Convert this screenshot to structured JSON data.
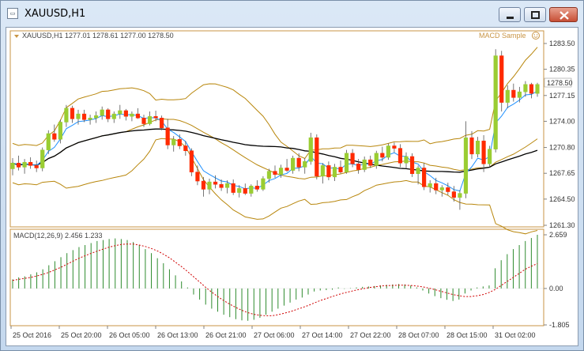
{
  "window": {
    "title": "XAUUSD,H1",
    "icon": "chart-window-icon",
    "controls": [
      "minimize-icon",
      "maximize-icon",
      "close-icon"
    ]
  },
  "chart_header": {
    "symbol_info": "XAUUSD,H1  1277.01 1278.61 1277.00 1278.50",
    "indicator_name": "MACD Sample",
    "indicator_icon": "smiley-face-icon"
  },
  "macd_label": "MACD(12,26,9) 2.456 1.233",
  "price_axis": {
    "labels": [
      "1283.50",
      "1280.35",
      "1277.15",
      "1274.00",
      "1270.80",
      "1267.65",
      "1264.50",
      "1261.30"
    ],
    "current_price": "1278.50"
  },
  "macd_axis": {
    "labels": [
      "2.659",
      "0.00",
      "-1.805"
    ]
  },
  "time_axis": {
    "labels": [
      "25 Oct 2016",
      "25 Oct 20:00",
      "26 Oct 05:00",
      "26 Oct 13:00",
      "26 Oct 21:00",
      "27 Oct 06:00",
      "27 Oct 14:00",
      "27 Oct 22:00",
      "28 Oct 07:00",
      "28 Oct 15:00",
      "31 Oct 02:00"
    ]
  },
  "colors": {
    "bull_candle": "#9acd32",
    "bear_candle": "#ff2a00",
    "bollinger": "#b8860b",
    "fast_ma": "#1e90ff",
    "slow_ma": "#000000",
    "macd_hist": "#2e8b2e",
    "macd_signal": "#d00000"
  },
  "chart_data": [
    {
      "type": "candlestick",
      "title": "XAUUSD,H1",
      "ylim": [
        1261.3,
        1283.5
      ],
      "x_tick_labels": [
        "25 Oct 2016",
        "25 Oct 20:00",
        "26 Oct 05:00",
        "26 Oct 13:00",
        "26 Oct 21:00",
        "27 Oct 06:00",
        "27 Oct 14:00",
        "27 Oct 22:00",
        "28 Oct 07:00",
        "28 Oct 15:00",
        "31 Oct 02:00"
      ],
      "candles": [
        [
          1268.2,
          1269.5,
          1267.4,
          1268.9
        ],
        [
          1268.9,
          1269.8,
          1268.0,
          1268.4
        ],
        [
          1268.4,
          1269.4,
          1267.6,
          1269.0
        ],
        [
          1269.0,
          1269.6,
          1268.2,
          1268.6
        ],
        [
          1268.6,
          1269.2,
          1267.8,
          1268.3
        ],
        [
          1268.3,
          1270.8,
          1267.9,
          1270.5
        ],
        [
          1270.5,
          1272.9,
          1270.0,
          1272.5
        ],
        [
          1272.5,
          1273.6,
          1271.5,
          1271.8
        ],
        [
          1271.8,
          1274.2,
          1271.3,
          1273.9
        ],
        [
          1273.9,
          1276.0,
          1273.3,
          1275.6
        ],
        [
          1275.6,
          1275.9,
          1273.8,
          1274.3
        ],
        [
          1274.3,
          1275.4,
          1273.6,
          1274.9
        ],
        [
          1274.9,
          1275.4,
          1273.9,
          1274.2
        ],
        [
          1274.2,
          1274.8,
          1273.6,
          1274.4
        ],
        [
          1274.4,
          1275.2,
          1273.8,
          1274.7
        ],
        [
          1274.7,
          1275.8,
          1274.2,
          1275.4
        ],
        [
          1275.4,
          1275.6,
          1273.9,
          1274.3
        ],
        [
          1274.3,
          1275.2,
          1273.8,
          1274.9
        ],
        [
          1274.9,
          1276.0,
          1274.3,
          1275.3
        ],
        [
          1275.3,
          1275.5,
          1274.1,
          1274.6
        ],
        [
          1274.6,
          1275.2,
          1274.0,
          1274.9
        ],
        [
          1274.9,
          1275.6,
          1274.3,
          1274.4
        ],
        [
          1274.4,
          1274.8,
          1273.3,
          1273.7
        ],
        [
          1273.7,
          1275.2,
          1273.5,
          1274.6
        ],
        [
          1274.6,
          1275.3,
          1274.0,
          1274.4
        ],
        [
          1274.4,
          1274.7,
          1272.9,
          1273.2
        ],
        [
          1273.2,
          1274.3,
          1270.6,
          1271.1
        ],
        [
          1271.1,
          1272.2,
          1270.3,
          1271.8
        ],
        [
          1271.8,
          1272.4,
          1270.6,
          1271.0
        ],
        [
          1271.0,
          1271.6,
          1269.8,
          1270.4
        ],
        [
          1270.4,
          1270.7,
          1267.3,
          1267.8
        ],
        [
          1267.8,
          1268.6,
          1266.2,
          1266.7
        ],
        [
          1266.7,
          1267.2,
          1264.8,
          1265.7
        ],
        [
          1265.7,
          1267.0,
          1265.1,
          1266.6
        ],
        [
          1266.6,
          1267.4,
          1265.8,
          1266.3
        ],
        [
          1266.3,
          1266.9,
          1265.5,
          1265.9
        ],
        [
          1265.9,
          1266.8,
          1265.2,
          1266.4
        ],
        [
          1266.4,
          1266.9,
          1265.0,
          1265.3
        ],
        [
          1265.3,
          1266.2,
          1264.7,
          1265.8
        ],
        [
          1265.8,
          1266.4,
          1265.0,
          1265.2
        ],
        [
          1265.2,
          1266.3,
          1264.8,
          1266.1
        ],
        [
          1266.1,
          1266.8,
          1265.4,
          1265.7
        ],
        [
          1265.7,
          1267.3,
          1265.5,
          1267.0
        ],
        [
          1267.0,
          1268.2,
          1266.5,
          1267.9
        ],
        [
          1267.9,
          1268.6,
          1267.1,
          1267.5
        ],
        [
          1267.5,
          1268.7,
          1267.1,
          1268.3
        ],
        [
          1268.3,
          1269.4,
          1267.8,
          1268.0
        ],
        [
          1268.0,
          1269.8,
          1267.6,
          1269.5
        ],
        [
          1269.5,
          1270.1,
          1267.9,
          1268.4
        ],
        [
          1268.4,
          1269.5,
          1267.6,
          1269.1
        ],
        [
          1269.1,
          1272.6,
          1268.7,
          1272.0
        ],
        [
          1272.0,
          1272.4,
          1266.9,
          1267.3
        ],
        [
          1267.3,
          1268.9,
          1266.4,
          1268.6
        ],
        [
          1268.6,
          1269.1,
          1266.8,
          1267.2
        ],
        [
          1267.2,
          1268.8,
          1266.7,
          1268.4
        ],
        [
          1268.4,
          1269.2,
          1267.6,
          1267.8
        ],
        [
          1267.8,
          1270.5,
          1267.6,
          1270.1
        ],
        [
          1270.1,
          1270.6,
          1268.4,
          1268.8
        ],
        [
          1268.8,
          1269.4,
          1267.6,
          1268.1
        ],
        [
          1268.1,
          1269.7,
          1267.8,
          1269.3
        ],
        [
          1269.3,
          1269.8,
          1268.3,
          1268.6
        ],
        [
          1268.6,
          1270.4,
          1268.2,
          1270.1
        ],
        [
          1270.1,
          1270.9,
          1269.1,
          1269.6
        ],
        [
          1269.6,
          1271.3,
          1269.3,
          1271.0
        ],
        [
          1271.0,
          1271.4,
          1270.2,
          1270.7
        ],
        [
          1270.7,
          1271.2,
          1268.4,
          1268.9
        ],
        [
          1268.9,
          1270.2,
          1268.3,
          1269.7
        ],
        [
          1269.7,
          1270.1,
          1267.2,
          1267.6
        ],
        [
          1267.6,
          1268.6,
          1266.3,
          1268.3
        ],
        [
          1268.3,
          1268.9,
          1265.6,
          1266.0
        ],
        [
          1266.0,
          1266.8,
          1265.3,
          1266.4
        ],
        [
          1266.4,
          1267.1,
          1265.1,
          1265.6
        ],
        [
          1265.6,
          1266.2,
          1264.8,
          1265.9
        ],
        [
          1265.9,
          1266.5,
          1265.0,
          1265.4
        ],
        [
          1265.4,
          1266.1,
          1264.2,
          1264.7
        ],
        [
          1264.7,
          1265.6,
          1263.2,
          1265.2
        ],
        [
          1265.2,
          1274.0,
          1264.6,
          1272.0
        ],
        [
          1272.0,
          1272.8,
          1269.4,
          1270.0
        ],
        [
          1270.0,
          1272.1,
          1269.6,
          1271.6
        ],
        [
          1271.6,
          1272.3,
          1267.8,
          1268.8
        ],
        [
          1268.8,
          1271.0,
          1268.4,
          1270.6
        ],
        [
          1270.6,
          1282.8,
          1270.2,
          1282.0
        ],
        [
          1282.0,
          1282.6,
          1275.2,
          1276.3
        ],
        [
          1276.3,
          1278.4,
          1275.6,
          1277.8
        ],
        [
          1277.8,
          1278.6,
          1276.4,
          1276.9
        ],
        [
          1276.9,
          1278.2,
          1276.3,
          1277.6
        ],
        [
          1277.6,
          1278.9,
          1277.0,
          1278.5
        ],
        [
          1278.5,
          1278.7,
          1276.8,
          1277.4
        ],
        [
          1277.4,
          1278.7,
          1277.0,
          1278.5
        ]
      ]
    },
    {
      "type": "bar",
      "title": "MACD(12,26,9) 2.456 1.233",
      "ylim": [
        -1.805,
        2.659
      ],
      "histogram": [
        0.45,
        0.55,
        0.6,
        0.7,
        0.8,
        0.95,
        1.15,
        1.35,
        1.55,
        1.75,
        1.9,
        2.05,
        2.15,
        2.25,
        2.35,
        2.4,
        2.45,
        2.48,
        2.45,
        2.4,
        2.3,
        2.15,
        1.95,
        1.75,
        1.5,
        1.25,
        0.95,
        0.65,
        0.35,
        0.05,
        -0.3,
        -0.55,
        -0.8,
        -1.0,
        -1.15,
        -1.3,
        -1.42,
        -1.52,
        -1.58,
        -1.6,
        -1.55,
        -1.45,
        -1.3,
        -1.15,
        -1.0,
        -0.85,
        -0.7,
        -0.55,
        -0.45,
        -0.3,
        -0.15,
        -0.1,
        -0.08,
        -0.06,
        0.05,
        -0.02,
        0.02,
        0.05,
        0.08,
        0.1,
        0.12,
        0.15,
        0.18,
        0.2,
        0.22,
        0.2,
        0.15,
        0.05,
        -0.1,
        -0.25,
        -0.38,
        -0.48,
        -0.56,
        -0.62,
        -0.55,
        -0.25,
        -0.1,
        0.05,
        0.1,
        0.15,
        1.0,
        1.4,
        1.7,
        1.95,
        2.15,
        2.35,
        2.5,
        2.659
      ],
      "signal": [
        0.4,
        0.45,
        0.5,
        0.55,
        0.62,
        0.7,
        0.8,
        0.92,
        1.05,
        1.2,
        1.35,
        1.5,
        1.62,
        1.74,
        1.85,
        1.95,
        2.05,
        2.12,
        2.18,
        2.2,
        2.2,
        2.15,
        2.08,
        1.98,
        1.86,
        1.7,
        1.52,
        1.3,
        1.08,
        0.84,
        0.58,
        0.32,
        0.06,
        -0.18,
        -0.4,
        -0.6,
        -0.78,
        -0.94,
        -1.08,
        -1.2,
        -1.28,
        -1.33,
        -1.35,
        -1.35,
        -1.3,
        -1.23,
        -1.15,
        -1.05,
        -0.95,
        -0.84,
        -0.72,
        -0.6,
        -0.5,
        -0.4,
        -0.3,
        -0.22,
        -0.15,
        -0.08,
        -0.02,
        0.04,
        0.08,
        0.12,
        0.14,
        0.15,
        0.16,
        0.16,
        0.15,
        0.12,
        0.08,
        0.02,
        -0.06,
        -0.14,
        -0.22,
        -0.3,
        -0.36,
        -0.4,
        -0.4,
        -0.36,
        -0.3,
        -0.2,
        -0.05,
        0.15,
        0.35,
        0.55,
        0.75,
        0.95,
        1.1,
        1.233
      ]
    }
  ]
}
